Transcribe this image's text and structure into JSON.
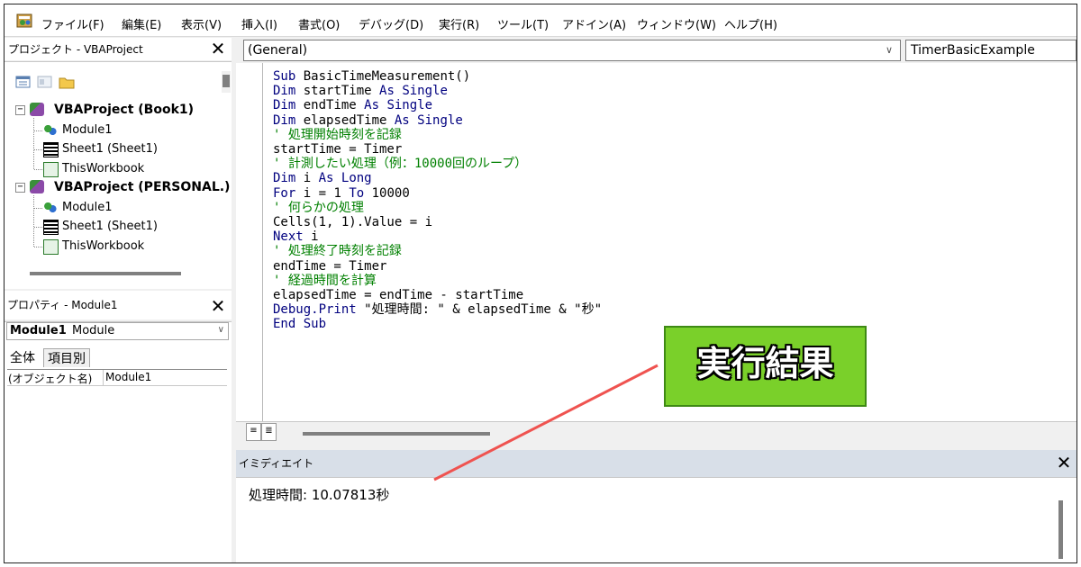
{
  "menu": [
    {
      "label": "ファイル(F)"
    },
    {
      "label": "編集(E)"
    },
    {
      "label": "表示(V)"
    },
    {
      "label": "挿入(I)"
    },
    {
      "label": "書式(O)"
    },
    {
      "label": "デバッグ(D)"
    },
    {
      "label": "実行(R)"
    },
    {
      "label": "ツール(T)"
    },
    {
      "label": "アドイン(A)"
    },
    {
      "label": "ウィンドウ(W)"
    },
    {
      "label": "ヘルプ(H)"
    }
  ],
  "project": {
    "title": "プロジェクト - VBAProject",
    "close": "✕",
    "tree": [
      {
        "label": "VBAProject (Book1)",
        "expander": "−",
        "children": [
          "Module1",
          "Sheet1 (Sheet1)",
          "ThisWorkbook"
        ]
      },
      {
        "label": "VBAProject (PERSONAL.)",
        "expander": "−",
        "children": [
          "Module1",
          "Sheet1 (Sheet1)",
          "ThisWorkbook"
        ]
      }
    ]
  },
  "properties": {
    "title": "プロパティ - Module1",
    "close": "✕",
    "object_name": "Module1",
    "object_type": "Module",
    "tabs": [
      "全体",
      "項目別"
    ],
    "row_name": "(オブジェクト名)",
    "row_value": "Module1"
  },
  "code_window": {
    "object_combo": "(General)",
    "procedure_combo": "TimerBasicExample",
    "lines": [
      "Sub BasicTimeMeasurement()",
      "Dim startTime As Single",
      "Dim endTime As Single",
      "Dim elapsedTime As Single",
      "' 処理開始時刻を記録",
      "startTime = Timer",
      "' 計測したい処理（例：10000回のループ）",
      "Dim i As Long",
      "For i = 1 To 10000",
      "' 何らかの処理",
      "Cells(1, 1).Value = i",
      "Next i",
      "' 処理終了時刻を記録",
      "endTime = Timer",
      "' 経過時間を計算",
      "elapsedTime = endTime - startTime",
      "Debug.Print \"処理時間: \" & elapsedTime & \"秒\"",
      "End Sub"
    ]
  },
  "immediate": {
    "title": "イミディエイト",
    "close": "✕",
    "output": "処理時間: 10.07813秒"
  },
  "callout": {
    "label": "実行結果",
    "color": "#7ad02a",
    "arrow_color": "#ef5350"
  }
}
